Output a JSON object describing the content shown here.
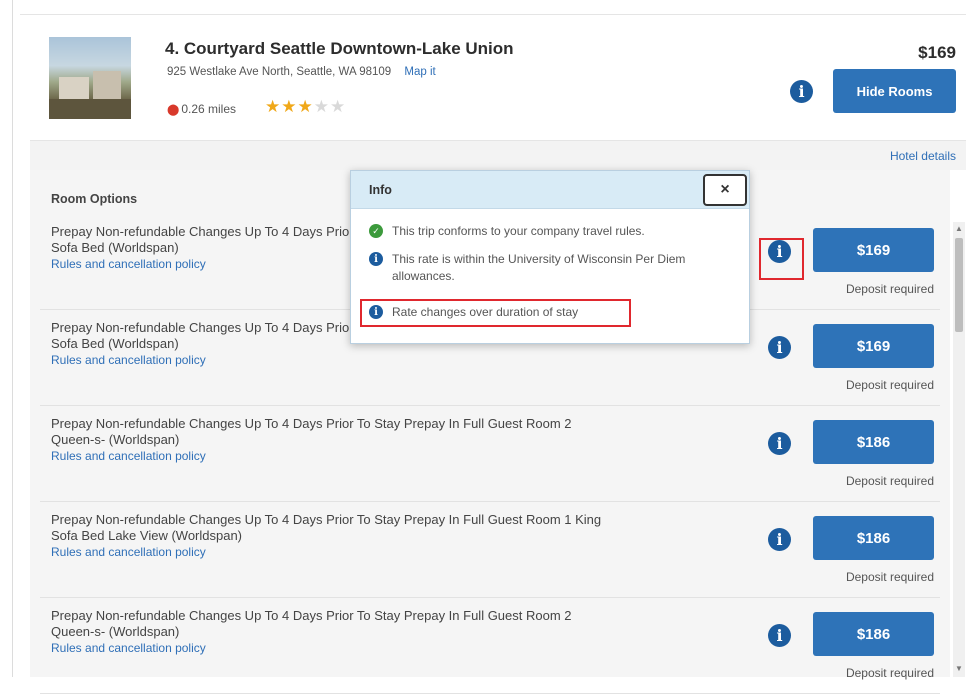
{
  "hotel": {
    "name": "4. Courtyard Seattle Downtown-Lake Union",
    "address": "925 Westlake Ave North, Seattle, WA 98109",
    "map_link": "Map it",
    "distance": "0.26 miles",
    "stars_filled": 3,
    "stars_total": 5,
    "price": "$169",
    "hide_rooms_label": "Hide Rooms",
    "details_link": "Hotel details"
  },
  "rooms": {
    "heading": "Room Options",
    "rules_link": "Rules and cancellation policy",
    "deposit_label": "Deposit required",
    "items": [
      {
        "line1": "Prepay Non-refundable Changes Up To 4 Days Prior To Stay Prepay In Full Guest Room 1 King",
        "line2": "Sofa Bed (Worldspan)",
        "price": "$169"
      },
      {
        "line1": "Prepay Non-refundable Changes Up To 4 Days Prior To Stay Prepay In Full Guest Room 1 King",
        "line2": "Sofa Bed (Worldspan)",
        "price": "$169"
      },
      {
        "line1": "Prepay Non-refundable Changes Up To 4 Days Prior To Stay Prepay In Full Guest Room 2",
        "line2": "Queen-s- (Worldspan)",
        "price": "$186"
      },
      {
        "line1": "Prepay Non-refundable Changes Up To 4 Days Prior To Stay Prepay In Full Guest Room 1 King",
        "line2": "Sofa Bed Lake View (Worldspan)",
        "price": "$186"
      },
      {
        "line1": "Prepay Non-refundable Changes Up To 4 Days Prior To Stay Prepay In Full Guest Room 2",
        "line2": "Queen-s- (Worldspan)",
        "price": "$186"
      }
    ]
  },
  "popover": {
    "title": "Info",
    "close_label": "×",
    "items": [
      {
        "icon": "check-circle-icon",
        "text": "This trip conforms to your company travel rules."
      },
      {
        "icon": "info-icon",
        "text": "This rate is within the University of Wisconsin Per Diem allowances."
      },
      {
        "icon": "info-icon",
        "text": "Rate changes over duration of stay"
      }
    ]
  },
  "icons": {
    "info_glyph": "i",
    "check_glyph": "✓",
    "pin_glyph": "📍",
    "star_glyph": "★"
  },
  "colors": {
    "primary_button": "#2e73b8",
    "link": "#2f6fb7",
    "info_icon": "#1c5c9e",
    "highlight": "#e0282e",
    "star": "#f0a819",
    "popover_header": "#d8ebf6"
  }
}
